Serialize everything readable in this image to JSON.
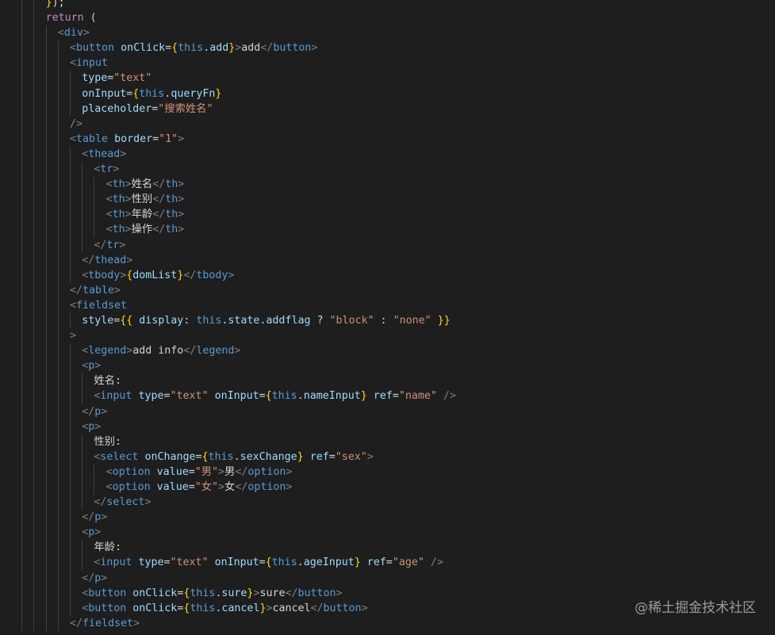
{
  "theme": {
    "background": "#1e1e1e",
    "colors": {
      "plain": "#d4d4d4",
      "punct": "#808080",
      "tag": "#569cd6",
      "attr": "#9cdcfe",
      "string": "#ce9178",
      "brace": "#ffd700",
      "keyword": "#c586c0",
      "this": "#569cd6",
      "prop": "#9cdcfe"
    }
  },
  "editor": {
    "language": "jsx",
    "lines": [
      {
        "indent": 3,
        "tokens": [
          [
            "brace",
            "}"
          ],
          [
            "plain",
            ");"
          ]
        ]
      },
      {
        "indent": 3,
        "tokens": [
          [
            "keyword",
            "return"
          ],
          [
            "plain",
            " ("
          ]
        ]
      },
      {
        "indent": 4,
        "tokens": [
          [
            "punct",
            "<"
          ],
          [
            "tag",
            "div"
          ],
          [
            "punct",
            ">"
          ]
        ]
      },
      {
        "indent": 5,
        "tokens": [
          [
            "punct",
            "<"
          ],
          [
            "tag",
            "button"
          ],
          [
            "plain",
            " "
          ],
          [
            "attr",
            "onClick"
          ],
          [
            "plain",
            "="
          ],
          [
            "brace",
            "{"
          ],
          [
            "this",
            "this"
          ],
          [
            "plain",
            "."
          ],
          [
            "prop",
            "add"
          ],
          [
            "brace",
            "}"
          ],
          [
            "punct",
            ">"
          ],
          [
            "jsxtext",
            "add"
          ],
          [
            "punct",
            "</"
          ],
          [
            "tag",
            "button"
          ],
          [
            "punct",
            ">"
          ]
        ]
      },
      {
        "indent": 5,
        "tokens": [
          [
            "punct",
            "<"
          ],
          [
            "tag",
            "input"
          ]
        ]
      },
      {
        "indent": 6,
        "tokens": [
          [
            "attr",
            "type"
          ],
          [
            "plain",
            "="
          ],
          [
            "string",
            "\"text\""
          ]
        ]
      },
      {
        "indent": 6,
        "tokens": [
          [
            "attr",
            "onInput"
          ],
          [
            "plain",
            "="
          ],
          [
            "brace",
            "{"
          ],
          [
            "this",
            "this"
          ],
          [
            "plain",
            "."
          ],
          [
            "prop",
            "queryFn"
          ],
          [
            "brace",
            "}"
          ]
        ]
      },
      {
        "indent": 6,
        "tokens": [
          [
            "attr",
            "placeholder"
          ],
          [
            "plain",
            "="
          ],
          [
            "string",
            "\"搜索姓名\""
          ]
        ]
      },
      {
        "indent": 5,
        "tokens": [
          [
            "punct",
            "/>"
          ]
        ]
      },
      {
        "indent": 5,
        "tokens": [
          [
            "punct",
            "<"
          ],
          [
            "tag",
            "table"
          ],
          [
            "plain",
            " "
          ],
          [
            "attr",
            "border"
          ],
          [
            "plain",
            "="
          ],
          [
            "string",
            "\"1\""
          ],
          [
            "punct",
            ">"
          ]
        ]
      },
      {
        "indent": 6,
        "tokens": [
          [
            "punct",
            "<"
          ],
          [
            "tag",
            "thead"
          ],
          [
            "punct",
            ">"
          ]
        ]
      },
      {
        "indent": 7,
        "tokens": [
          [
            "punct",
            "<"
          ],
          [
            "tag",
            "tr"
          ],
          [
            "punct",
            ">"
          ]
        ]
      },
      {
        "indent": 8,
        "tokens": [
          [
            "punct",
            "<"
          ],
          [
            "tag",
            "th"
          ],
          [
            "punct",
            ">"
          ],
          [
            "jsxtext",
            "姓名"
          ],
          [
            "punct",
            "</"
          ],
          [
            "tag",
            "th"
          ],
          [
            "punct",
            ">"
          ]
        ]
      },
      {
        "indent": 8,
        "tokens": [
          [
            "punct",
            "<"
          ],
          [
            "tag",
            "th"
          ],
          [
            "punct",
            ">"
          ],
          [
            "jsxtext",
            "性别"
          ],
          [
            "punct",
            "</"
          ],
          [
            "tag",
            "th"
          ],
          [
            "punct",
            ">"
          ]
        ]
      },
      {
        "indent": 8,
        "tokens": [
          [
            "punct",
            "<"
          ],
          [
            "tag",
            "th"
          ],
          [
            "punct",
            ">"
          ],
          [
            "jsxtext",
            "年龄"
          ],
          [
            "punct",
            "</"
          ],
          [
            "tag",
            "th"
          ],
          [
            "punct",
            ">"
          ]
        ]
      },
      {
        "indent": 8,
        "tokens": [
          [
            "punct",
            "<"
          ],
          [
            "tag",
            "th"
          ],
          [
            "punct",
            ">"
          ],
          [
            "jsxtext",
            "操作"
          ],
          [
            "punct",
            "</"
          ],
          [
            "tag",
            "th"
          ],
          [
            "punct",
            ">"
          ]
        ]
      },
      {
        "indent": 7,
        "tokens": [
          [
            "punct",
            "</"
          ],
          [
            "tag",
            "tr"
          ],
          [
            "punct",
            ">"
          ]
        ]
      },
      {
        "indent": 6,
        "tokens": [
          [
            "punct",
            "</"
          ],
          [
            "tag",
            "thead"
          ],
          [
            "punct",
            ">"
          ]
        ]
      },
      {
        "indent": 6,
        "tokens": [
          [
            "punct",
            "<"
          ],
          [
            "tag",
            "tbody"
          ],
          [
            "punct",
            ">"
          ],
          [
            "brace",
            "{"
          ],
          [
            "prop",
            "domList"
          ],
          [
            "brace",
            "}"
          ],
          [
            "punct",
            "</"
          ],
          [
            "tag",
            "tbody"
          ],
          [
            "punct",
            ">"
          ]
        ]
      },
      {
        "indent": 5,
        "tokens": [
          [
            "punct",
            "</"
          ],
          [
            "tag",
            "table"
          ],
          [
            "punct",
            ">"
          ]
        ]
      },
      {
        "indent": 5,
        "tokens": [
          [
            "punct",
            "<"
          ],
          [
            "tag",
            "fieldset"
          ]
        ]
      },
      {
        "indent": 6,
        "tokens": [
          [
            "attr",
            "style"
          ],
          [
            "plain",
            "="
          ],
          [
            "brace",
            "{{"
          ],
          [
            "plain",
            " "
          ],
          [
            "prop",
            "display"
          ],
          [
            "plain",
            ": "
          ],
          [
            "this",
            "this"
          ],
          [
            "plain",
            "."
          ],
          [
            "prop",
            "state"
          ],
          [
            "plain",
            "."
          ],
          [
            "prop",
            "addflag"
          ],
          [
            "plain",
            " ? "
          ],
          [
            "string",
            "\"block\""
          ],
          [
            "plain",
            " : "
          ],
          [
            "string",
            "\"none\""
          ],
          [
            "plain",
            " "
          ],
          [
            "brace",
            "}}"
          ]
        ]
      },
      {
        "indent": 5,
        "tokens": [
          [
            "punct",
            ">"
          ]
        ]
      },
      {
        "indent": 6,
        "tokens": [
          [
            "punct",
            "<"
          ],
          [
            "tag",
            "legend"
          ],
          [
            "punct",
            ">"
          ],
          [
            "jsxtext",
            "add info"
          ],
          [
            "punct",
            "</"
          ],
          [
            "tag",
            "legend"
          ],
          [
            "punct",
            ">"
          ]
        ]
      },
      {
        "indent": 6,
        "tokens": [
          [
            "punct",
            "<"
          ],
          [
            "tag",
            "p"
          ],
          [
            "punct",
            ">"
          ]
        ]
      },
      {
        "indent": 7,
        "tokens": [
          [
            "jsxtext",
            "姓名:"
          ]
        ]
      },
      {
        "indent": 7,
        "tokens": [
          [
            "punct",
            "<"
          ],
          [
            "tag",
            "input"
          ],
          [
            "plain",
            " "
          ],
          [
            "attr",
            "type"
          ],
          [
            "plain",
            "="
          ],
          [
            "string",
            "\"text\""
          ],
          [
            "plain",
            " "
          ],
          [
            "attr",
            "onInput"
          ],
          [
            "plain",
            "="
          ],
          [
            "brace",
            "{"
          ],
          [
            "this",
            "this"
          ],
          [
            "plain",
            "."
          ],
          [
            "prop",
            "nameInput"
          ],
          [
            "brace",
            "}"
          ],
          [
            "plain",
            " "
          ],
          [
            "attr",
            "ref"
          ],
          [
            "plain",
            "="
          ],
          [
            "string",
            "\"name\""
          ],
          [
            "plain",
            " "
          ],
          [
            "punct",
            "/>"
          ]
        ]
      },
      {
        "indent": 6,
        "tokens": [
          [
            "punct",
            "</"
          ],
          [
            "tag",
            "p"
          ],
          [
            "punct",
            ">"
          ]
        ]
      },
      {
        "indent": 6,
        "tokens": [
          [
            "punct",
            "<"
          ],
          [
            "tag",
            "p"
          ],
          [
            "punct",
            ">"
          ]
        ]
      },
      {
        "indent": 7,
        "tokens": [
          [
            "jsxtext",
            "性别:"
          ]
        ]
      },
      {
        "indent": 7,
        "tokens": [
          [
            "punct",
            "<"
          ],
          [
            "tag",
            "select"
          ],
          [
            "plain",
            " "
          ],
          [
            "attr",
            "onChange"
          ],
          [
            "plain",
            "="
          ],
          [
            "brace",
            "{"
          ],
          [
            "this",
            "this"
          ],
          [
            "plain",
            "."
          ],
          [
            "prop",
            "sexChange"
          ],
          [
            "brace",
            "}"
          ],
          [
            "plain",
            " "
          ],
          [
            "attr",
            "ref"
          ],
          [
            "plain",
            "="
          ],
          [
            "string",
            "\"sex\""
          ],
          [
            "punct",
            ">"
          ]
        ]
      },
      {
        "indent": 8,
        "tokens": [
          [
            "punct",
            "<"
          ],
          [
            "tag",
            "option"
          ],
          [
            "plain",
            " "
          ],
          [
            "attr",
            "value"
          ],
          [
            "plain",
            "="
          ],
          [
            "string",
            "\"男\""
          ],
          [
            "punct",
            ">"
          ],
          [
            "jsxtext",
            "男"
          ],
          [
            "punct",
            "</"
          ],
          [
            "tag",
            "option"
          ],
          [
            "punct",
            ">"
          ]
        ]
      },
      {
        "indent": 8,
        "tokens": [
          [
            "punct",
            "<"
          ],
          [
            "tag",
            "option"
          ],
          [
            "plain",
            " "
          ],
          [
            "attr",
            "value"
          ],
          [
            "plain",
            "="
          ],
          [
            "string",
            "\"女\""
          ],
          [
            "punct",
            ">"
          ],
          [
            "jsxtext",
            "女"
          ],
          [
            "punct",
            "</"
          ],
          [
            "tag",
            "option"
          ],
          [
            "punct",
            ">"
          ]
        ]
      },
      {
        "indent": 7,
        "tokens": [
          [
            "punct",
            "</"
          ],
          [
            "tag",
            "select"
          ],
          [
            "punct",
            ">"
          ]
        ]
      },
      {
        "indent": 6,
        "tokens": [
          [
            "punct",
            "</"
          ],
          [
            "tag",
            "p"
          ],
          [
            "punct",
            ">"
          ]
        ]
      },
      {
        "indent": 6,
        "tokens": [
          [
            "punct",
            "<"
          ],
          [
            "tag",
            "p"
          ],
          [
            "punct",
            ">"
          ]
        ]
      },
      {
        "indent": 7,
        "tokens": [
          [
            "jsxtext",
            "年龄:"
          ]
        ]
      },
      {
        "indent": 7,
        "tokens": [
          [
            "punct",
            "<"
          ],
          [
            "tag",
            "input"
          ],
          [
            "plain",
            " "
          ],
          [
            "attr",
            "type"
          ],
          [
            "plain",
            "="
          ],
          [
            "string",
            "\"text\""
          ],
          [
            "plain",
            " "
          ],
          [
            "attr",
            "onInput"
          ],
          [
            "plain",
            "="
          ],
          [
            "brace",
            "{"
          ],
          [
            "this",
            "this"
          ],
          [
            "plain",
            "."
          ],
          [
            "prop",
            "ageInput"
          ],
          [
            "brace",
            "}"
          ],
          [
            "plain",
            " "
          ],
          [
            "attr",
            "ref"
          ],
          [
            "plain",
            "="
          ],
          [
            "string",
            "\"age\""
          ],
          [
            "plain",
            " "
          ],
          [
            "punct",
            "/>"
          ]
        ]
      },
      {
        "indent": 6,
        "tokens": [
          [
            "punct",
            "</"
          ],
          [
            "tag",
            "p"
          ],
          [
            "punct",
            ">"
          ]
        ]
      },
      {
        "indent": 6,
        "tokens": [
          [
            "punct",
            "<"
          ],
          [
            "tag",
            "button"
          ],
          [
            "plain",
            " "
          ],
          [
            "attr",
            "onClick"
          ],
          [
            "plain",
            "="
          ],
          [
            "brace",
            "{"
          ],
          [
            "this",
            "this"
          ],
          [
            "plain",
            "."
          ],
          [
            "prop",
            "sure"
          ],
          [
            "brace",
            "}"
          ],
          [
            "punct",
            ">"
          ],
          [
            "jsxtext",
            "sure"
          ],
          [
            "punct",
            "</"
          ],
          [
            "tag",
            "button"
          ],
          [
            "punct",
            ">"
          ]
        ]
      },
      {
        "indent": 6,
        "tokens": [
          [
            "punct",
            "<"
          ],
          [
            "tag",
            "button"
          ],
          [
            "plain",
            " "
          ],
          [
            "attr",
            "onClick"
          ],
          [
            "plain",
            "="
          ],
          [
            "brace",
            "{"
          ],
          [
            "this",
            "this"
          ],
          [
            "plain",
            "."
          ],
          [
            "prop",
            "cancel"
          ],
          [
            "brace",
            "}"
          ],
          [
            "punct",
            ">"
          ],
          [
            "jsxtext",
            "cancel"
          ],
          [
            "punct",
            "</"
          ],
          [
            "tag",
            "button"
          ],
          [
            "punct",
            ">"
          ]
        ]
      },
      {
        "indent": 5,
        "tokens": [
          [
            "punct",
            "</"
          ],
          [
            "tag",
            "fieldset"
          ],
          [
            "punct",
            ">"
          ]
        ]
      }
    ]
  },
  "watermark": {
    "text": "@稀土掘金技术社区"
  }
}
